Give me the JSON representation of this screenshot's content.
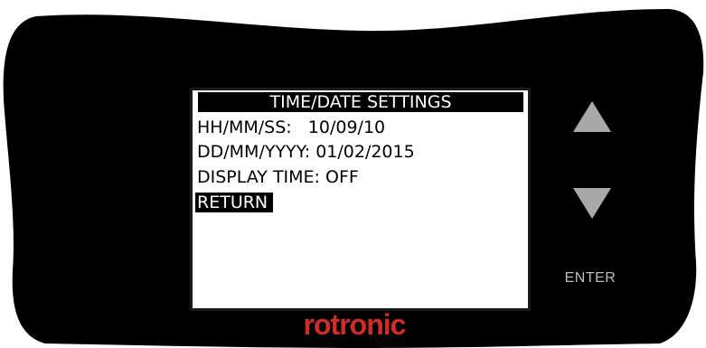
{
  "screen": {
    "title": "TIME/DATE SETTINGS",
    "lines": [
      "HH/MM/SS:   10/09/10",
      "DD/MM/YYYY: 01/02/2015",
      "DISPLAY TIME: OFF",
      "RETURN"
    ],
    "selected_index": 3
  },
  "buttons": {
    "up_icon": "triangle-up-icon",
    "down_icon": "triangle-down-icon",
    "enter_label": "ENTER"
  },
  "brand": {
    "logo_text": "rotronic",
    "color": "#d42b25"
  },
  "colors": {
    "device_body": "#000000",
    "arrow": "#a9a9a9",
    "enter_text": "#bdbdbd"
  }
}
